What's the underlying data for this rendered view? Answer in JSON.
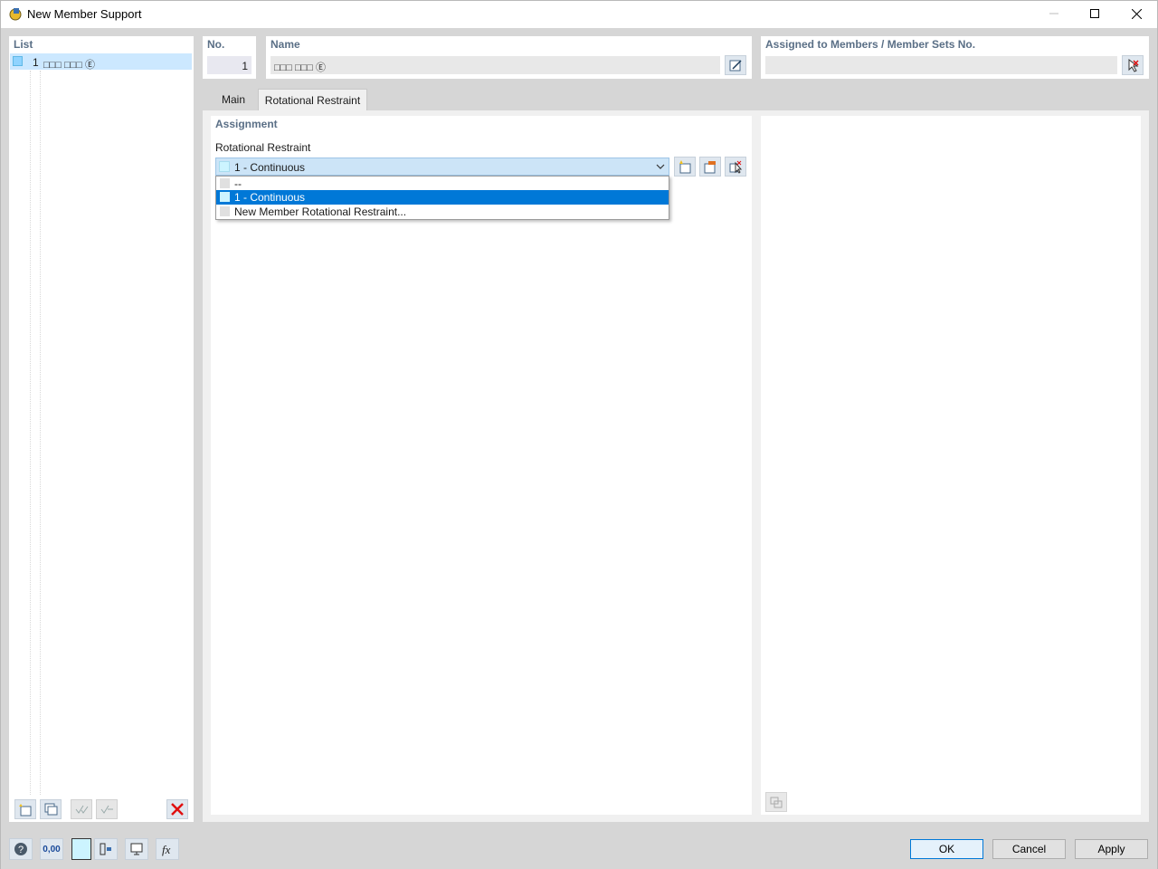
{
  "window": {
    "title": "New Member Support"
  },
  "list_panel": {
    "header": "List",
    "items": [
      {
        "number": "1",
        "name": "□□□ □□□ Ⓔ"
      }
    ]
  },
  "number_panel": {
    "header": "No.",
    "value": "1"
  },
  "name_panel": {
    "header": "Name",
    "value": "□□□ □□□ Ⓔ"
  },
  "assigned_panel": {
    "header": "Assigned to Members / Member Sets No.",
    "value": ""
  },
  "tabs": [
    {
      "label": "Main",
      "active": false
    },
    {
      "label": "Rotational Restraint",
      "active": true
    }
  ],
  "assignment": {
    "header": "Assignment",
    "field_label": "Rotational Restraint",
    "selected": "1 - Continuous",
    "options": [
      {
        "label": "--",
        "highlighted": false
      },
      {
        "label": "1 - Continuous",
        "highlighted": true
      },
      {
        "label": "New Member Rotational Restraint...",
        "highlighted": false
      }
    ]
  },
  "footer": {
    "ok_label": "OK",
    "cancel_label": "Cancel",
    "apply_label": "Apply",
    "decimal_icon_text": "0,00"
  },
  "colors": {
    "selection_blue": "#0078d7",
    "light_cyan": "#ccf4ff",
    "header_text": "#5a6f86",
    "combo_bg": "#cce4f7"
  }
}
